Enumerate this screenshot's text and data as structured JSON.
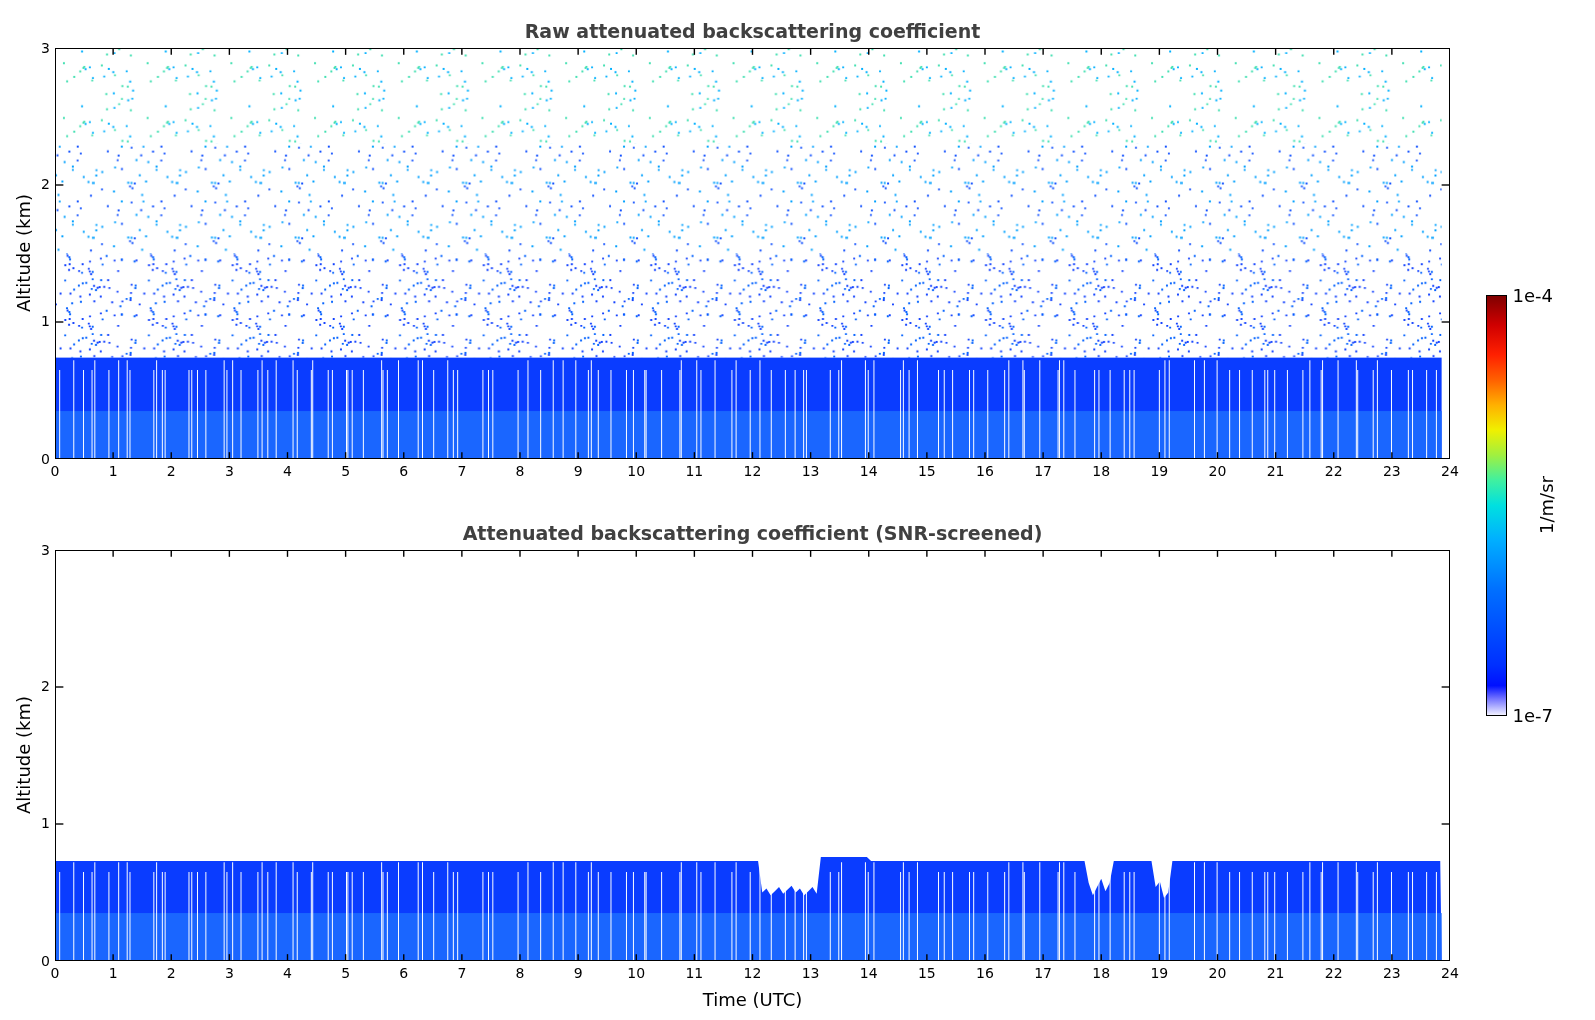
{
  "panels": [
    {
      "title": "Raw attenuated backscattering coefficient",
      "kind": "raw",
      "ylabel": "Altitude (km)",
      "yticks": [
        "3",
        "2",
        "1",
        "0"
      ],
      "xticks": [
        "0",
        "1",
        "2",
        "3",
        "4",
        "5",
        "6",
        "7",
        "8",
        "9",
        "10",
        "11",
        "12",
        "13",
        "14",
        "15",
        "16",
        "17",
        "18",
        "19",
        "20",
        "21",
        "22",
        "23",
        "24"
      ]
    },
    {
      "title": "Attenuated backscattering coefficient (SNR-screened)",
      "kind": "screened",
      "ylabel": "Altitude (km)",
      "yticks": [
        "3",
        "2",
        "1",
        "0"
      ],
      "xticks": [
        "0",
        "1",
        "2",
        "3",
        "4",
        "5",
        "6",
        "7",
        "8",
        "9",
        "10",
        "11",
        "12",
        "13",
        "14",
        "15",
        "16",
        "17",
        "18",
        "19",
        "20",
        "21",
        "22",
        "23",
        "24"
      ],
      "xlabel": "Time (UTC)"
    }
  ],
  "colorbar": {
    "max_label": "1e-4",
    "min_label": "1e-7",
    "unit": "1/m/sr"
  }
}
